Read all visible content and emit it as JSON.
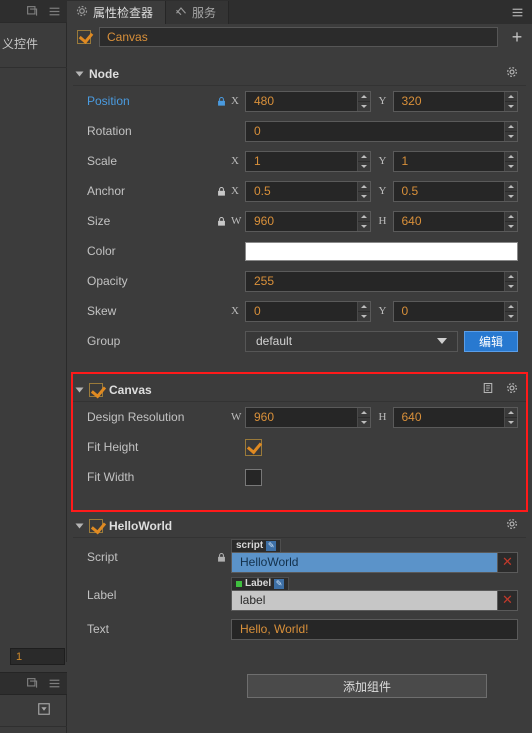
{
  "left_panel": {
    "label": "义控件",
    "number_value": "1",
    "icons": [
      "refresh-icon",
      "menu-icon",
      "add-panel-icon"
    ]
  },
  "tabs": [
    {
      "label": "属性检查器",
      "icon": "gear-icon",
      "active": true
    },
    {
      "label": "服务",
      "icon": "service-icon",
      "active": false
    }
  ],
  "toolbar": {
    "menu_icon": "menu-icon"
  },
  "node_name": {
    "value": "Canvas",
    "checked": true,
    "add_label": "+"
  },
  "sections": [
    {
      "id": "node",
      "title": "Node",
      "has_checkbox": false,
      "icons": [
        "gear-icon"
      ],
      "rows": [
        {
          "label": "Position",
          "label_style": "link",
          "lock": true,
          "type": "xy",
          "x_axis": "X",
          "x_value": "480",
          "y_axis": "Y",
          "y_value": "320"
        },
        {
          "label": "Rotation",
          "lock": false,
          "type": "single",
          "value": "0"
        },
        {
          "label": "Scale",
          "lock": false,
          "type": "xy",
          "x_axis": "X",
          "x_value": "1",
          "y_axis": "Y",
          "y_value": "1"
        },
        {
          "label": "Anchor",
          "lock": true,
          "type": "xy",
          "x_axis": "X",
          "x_value": "0.5",
          "y_axis": "Y",
          "y_value": "0.5"
        },
        {
          "label": "Size",
          "lock": true,
          "type": "xy",
          "x_axis": "W",
          "x_value": "960",
          "y_axis": "H",
          "y_value": "640"
        },
        {
          "label": "Color",
          "lock": false,
          "type": "color",
          "value": "#ffffff"
        },
        {
          "label": "Opacity",
          "lock": false,
          "type": "single",
          "value": "255"
        },
        {
          "label": "Skew",
          "lock": false,
          "type": "xy",
          "x_axis": "X",
          "x_value": "0",
          "y_axis": "Y",
          "y_value": "0"
        },
        {
          "label": "Group",
          "lock": false,
          "type": "select",
          "value": "default",
          "button_label": "编辑"
        }
      ]
    },
    {
      "id": "canvas",
      "title": "Canvas",
      "has_checkbox": true,
      "checked": true,
      "highlighted": true,
      "icons": [
        "help-icon",
        "gear-icon"
      ],
      "rows": [
        {
          "label": "Design Resolution",
          "lock": false,
          "type": "xy",
          "x_axis": "W",
          "x_value": "960",
          "y_axis": "H",
          "y_value": "640"
        },
        {
          "label": "Fit Height",
          "type": "checkbox",
          "checked": true
        },
        {
          "label": "Fit Width",
          "type": "checkbox",
          "checked": false
        }
      ]
    },
    {
      "id": "helloworld",
      "title": "HelloWorld",
      "has_checkbox": true,
      "checked": true,
      "icons": [
        "gear-icon"
      ],
      "rows": [
        {
          "label": "Script",
          "lock": true,
          "type": "asset",
          "badge": "script",
          "badge_dot": false,
          "value": "HelloWorld",
          "style": "blue"
        },
        {
          "label": "Label",
          "lock": false,
          "type": "asset",
          "badge": "Label",
          "badge_dot": true,
          "value": "label",
          "style": "grey"
        },
        {
          "label": "Text",
          "lock": false,
          "type": "single",
          "value": "Hello, World!"
        }
      ]
    }
  ],
  "add_component_button": {
    "label": "添加组件"
  },
  "colors": {
    "accent_orange": "#d9903a",
    "highlight_red": "#ff1a1a",
    "link_blue": "#4a9be0",
    "button_blue": "#2879d0"
  }
}
